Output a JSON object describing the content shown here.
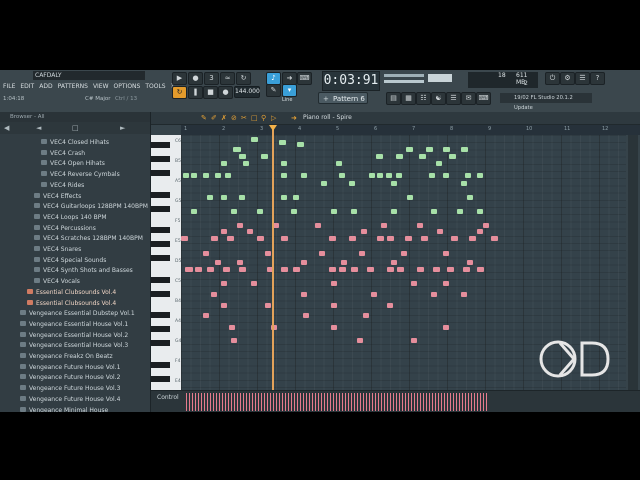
{
  "titlebar": {
    "project": "CAFDALY"
  },
  "menu": [
    "FILE",
    "EDIT",
    "ADD",
    "PATTERNS",
    "VIEW",
    "OPTIONS",
    "TOOLS",
    "?"
  ],
  "hint": {
    "time": "1:04:18",
    "scale": "C# Major",
    "edit": "Ctrl / 13"
  },
  "transport": {
    "time": "0:03:91",
    "time_small": "M:S:CS",
    "tempo": "144.000",
    "snap": "Line",
    "pattern": "Pattern 6"
  },
  "cpu": {
    "voices": "18",
    "memory": "611 MB",
    "cores": "2"
  },
  "news": {
    "date": "19/02",
    "text": "FL Studio 20.1.2 Update"
  },
  "browser": {
    "header": "Browser - All",
    "items": [
      {
        "label": "VEC4 Closed Hihats",
        "indent": 3
      },
      {
        "label": "VEC4 Crash",
        "indent": 3
      },
      {
        "label": "VEC4 Open Hihats",
        "indent": 3
      },
      {
        "label": "VEC4 Reverse Cymbals",
        "indent": 3
      },
      {
        "label": "VEC4 Rides",
        "indent": 3
      },
      {
        "label": "VEC4 Effects",
        "indent": 2
      },
      {
        "label": "VEC4 Guitarloops 128BPM 140BPM",
        "indent": 2
      },
      {
        "label": "VEC4 Loops 140 BPM",
        "indent": 2
      },
      {
        "label": "VEC4 Percussions",
        "indent": 2
      },
      {
        "label": "VEC4 Scratches 128BPM 140BPM",
        "indent": 2
      },
      {
        "label": "VEC4 Snares",
        "indent": 2
      },
      {
        "label": "VEC4 Special Sounds",
        "indent": 2
      },
      {
        "label": "VEC4 Synth Shots and Basses",
        "indent": 2
      },
      {
        "label": "VEC4 Vocals",
        "indent": 2
      },
      {
        "label": "Essential Clubsounds Vol.4",
        "indent": 1,
        "hl": true
      },
      {
        "label": "Essential Clubsounds Vol.4",
        "indent": 1,
        "hl": true
      },
      {
        "label": "Vengeance Essential Dubstep Vol.1",
        "indent": 0
      },
      {
        "label": "Vengeance Essential House Vol.1",
        "indent": 0
      },
      {
        "label": "Vengeance Essential House Vol.2",
        "indent": 0
      },
      {
        "label": "Vengeance Essential House Vol.3",
        "indent": 0
      },
      {
        "label": "Vengeance Freakz On Beatz",
        "indent": 0
      },
      {
        "label": "Vengeance Future House Vol.1",
        "indent": 0
      },
      {
        "label": "Vengeance Future House Vol.2",
        "indent": 0
      },
      {
        "label": "Vengeance Future House Vol.3",
        "indent": 0
      },
      {
        "label": "Vengeance Future House Vol.4",
        "indent": 0
      },
      {
        "label": "Vengeance Minimal House",
        "indent": 0
      }
    ]
  },
  "pianoroll": {
    "title": "Piano roll - Spire",
    "control_label": "Control",
    "bars": [
      "1",
      "2",
      "3",
      "4",
      "5",
      "6",
      "7",
      "8",
      "9",
      "10",
      "11",
      "12"
    ],
    "key_labels": [
      "C6",
      "B5",
      "A5",
      "G5",
      "F5",
      "E5",
      "D5",
      "C5",
      "B4",
      "A4",
      "G4",
      "F4",
      "E4"
    ]
  },
  "colors": {
    "note_high": "#a7e0a8",
    "note_low": "#e58e9c",
    "accent": "#e39b2c",
    "playhead": "#e3a25a"
  }
}
